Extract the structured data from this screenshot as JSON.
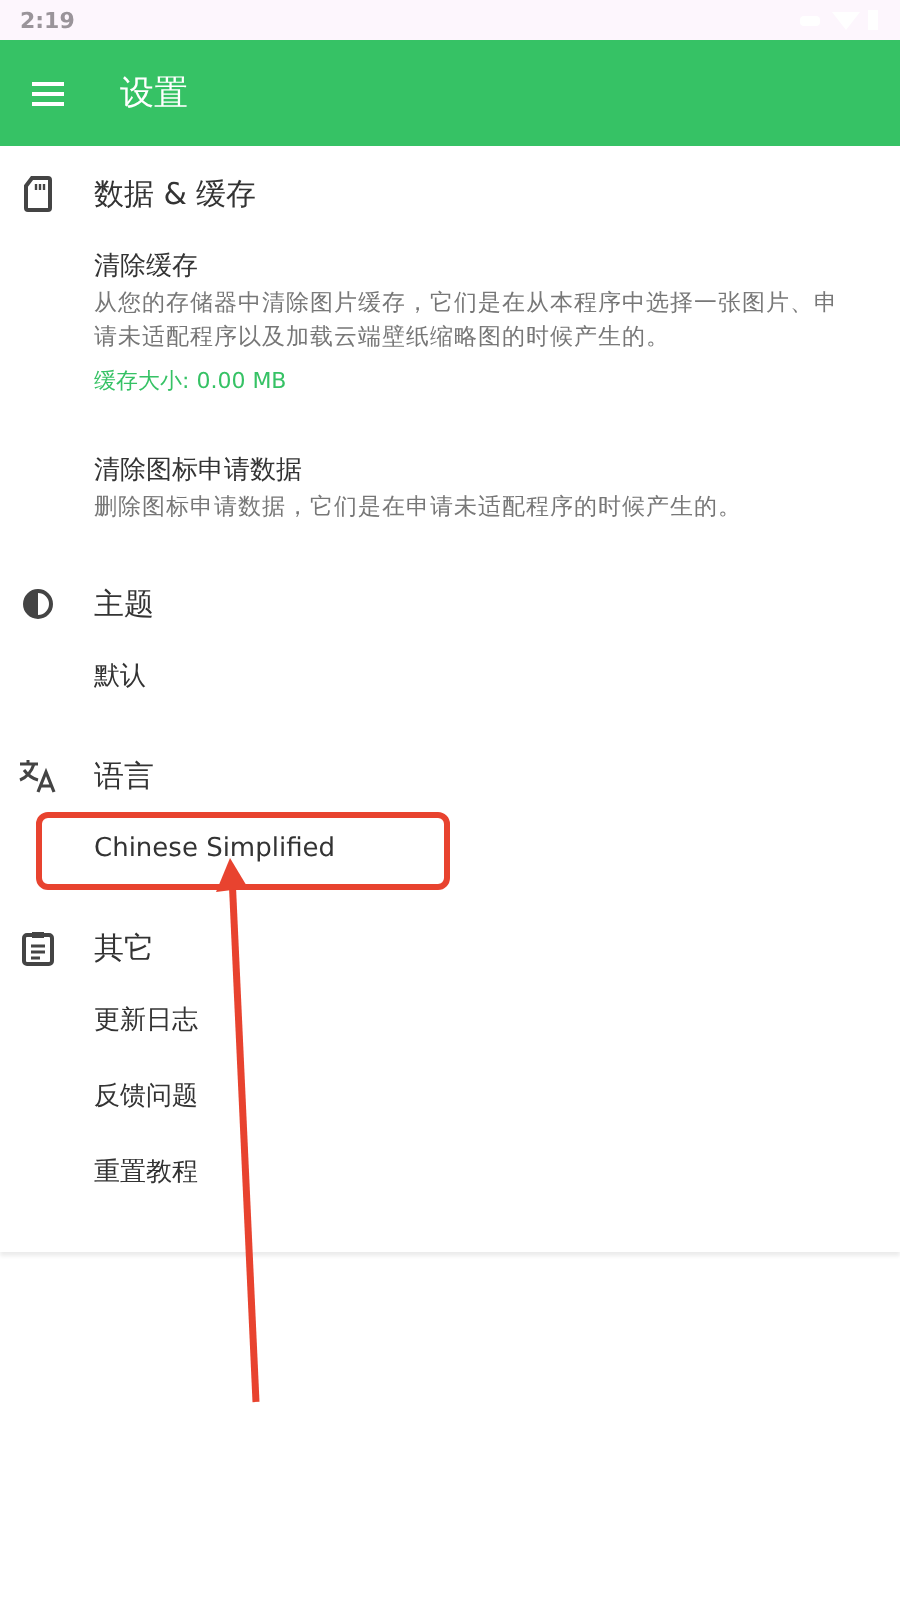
{
  "status_bar": {
    "time": "2:19"
  },
  "toolbar": {
    "title": "设置"
  },
  "sections": [
    {
      "title": "数据 & 缓存",
      "items": [
        {
          "title": "清除缓存",
          "summary": "从您的存储器中清除图片缓存，它们是在从本程序中选择一张图片、申请未适配程序以及加载云端壁纸缩略图的时候产生的。",
          "note": "缓存大小: 0.00 MB"
        },
        {
          "title": "清除图标申请数据",
          "summary": "删除图标申请数据，它们是在申请未适配程序的时候产生的。"
        }
      ]
    },
    {
      "title": "主题",
      "items": [
        {
          "title": "默认"
        }
      ]
    },
    {
      "title": "语言",
      "items": [
        {
          "title": "Chinese Simplified",
          "highlighted": true
        }
      ]
    },
    {
      "title": "其它",
      "items": [
        {
          "title": "更新日志"
        },
        {
          "title": "反馈问题"
        },
        {
          "title": "重置教程"
        }
      ]
    }
  ]
}
